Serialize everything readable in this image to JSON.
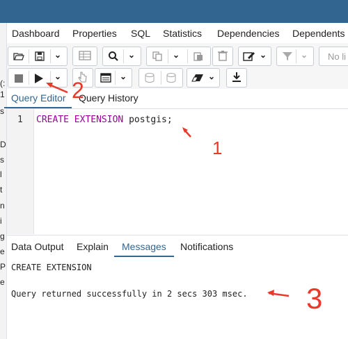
{
  "tabs": [
    "Dashboard",
    "Properties",
    "SQL",
    "Statistics",
    "Dependencies",
    "Dependents"
  ],
  "toolbar": {
    "filter_placeholder": "No li",
    "icons": [
      "open-file-icon",
      "save-icon",
      "chevron-down-icon",
      "grid-icon",
      "search-icon",
      "chevron-down-icon",
      "copy-icon",
      "chevron-down-icon",
      "paste-icon",
      "delete-icon",
      "edit-icon",
      "chevron-down-icon",
      "filter-icon",
      "chevron-down-icon",
      "stop-icon",
      "play-icon",
      "chevron-down-icon",
      "pointer-icon",
      "explain-icon",
      "chevron-down-icon",
      "commit-icon",
      "rollback-icon",
      "eraser-icon",
      "chevron-down-icon",
      "download-icon"
    ]
  },
  "left_strip": [
    "(:",
    "1",
    "s",
    "D",
    "s",
    "l",
    "t",
    "n",
    "i",
    "g",
    "e",
    "P",
    "e"
  ],
  "query_tabs": {
    "editor": "Query Editor",
    "history": "Query History"
  },
  "editor": {
    "line_number": "1",
    "keyword1": "CREATE",
    "keyword2": "EXTENSION",
    "rest": "postgis;"
  },
  "output_tabs": [
    "Data Output",
    "Explain",
    "Messages",
    "Notifications"
  ],
  "messages": {
    "line1": "CREATE EXTENSION",
    "line2": "Query returned successfully in 2 secs 303 msec."
  },
  "annotations": {
    "one": "1",
    "two": "2",
    "three": "3",
    "color": "#e8392b"
  },
  "colors": {
    "titlebar": "#326690",
    "accent": "#326690",
    "keyword": "#990099"
  }
}
